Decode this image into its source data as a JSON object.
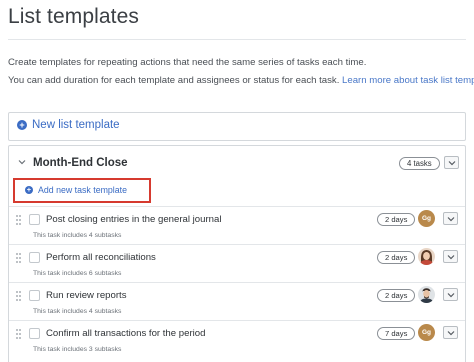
{
  "page": {
    "title": "List templates",
    "intro_line1": "Create templates for repeating actions that need the same series of tasks each time.",
    "intro_line2_text": "You can add duration for each template and assignees or status for each task.",
    "intro_link": "Learn more about task list templates"
  },
  "new_list_template": {
    "label": "New list template",
    "icon": "plus-circle-icon"
  },
  "template": {
    "name": "Month-End Close",
    "tasks_badge": "4 tasks",
    "add_task_label": "Add new task template",
    "tasks": [
      {
        "title": "Post closing entries in the general journal",
        "subtasks": "This task includes 4 subtasks",
        "duration": "2 days",
        "assignee": {
          "type": "initials",
          "initials": "Gg"
        }
      },
      {
        "title": "Perform all reconciliations",
        "subtasks": "This task includes 6 subtasks",
        "duration": "2 days",
        "assignee": {
          "type": "photo",
          "icon": "woman-avatar"
        }
      },
      {
        "title": "Run review reports",
        "subtasks": "This task includes 4 subtasks",
        "duration": "2 days",
        "assignee": {
          "type": "photo",
          "icon": "man-avatar"
        }
      },
      {
        "title": "Confirm all transactions for the period",
        "subtasks": "This task includes 3 subtasks",
        "duration": "7 days",
        "assignee": {
          "type": "initials",
          "initials": "Gg"
        }
      }
    ]
  },
  "colors": {
    "accent": "#3b6cc4",
    "highlight": "#d63a2f",
    "initials_avatar": "#b9894b"
  }
}
